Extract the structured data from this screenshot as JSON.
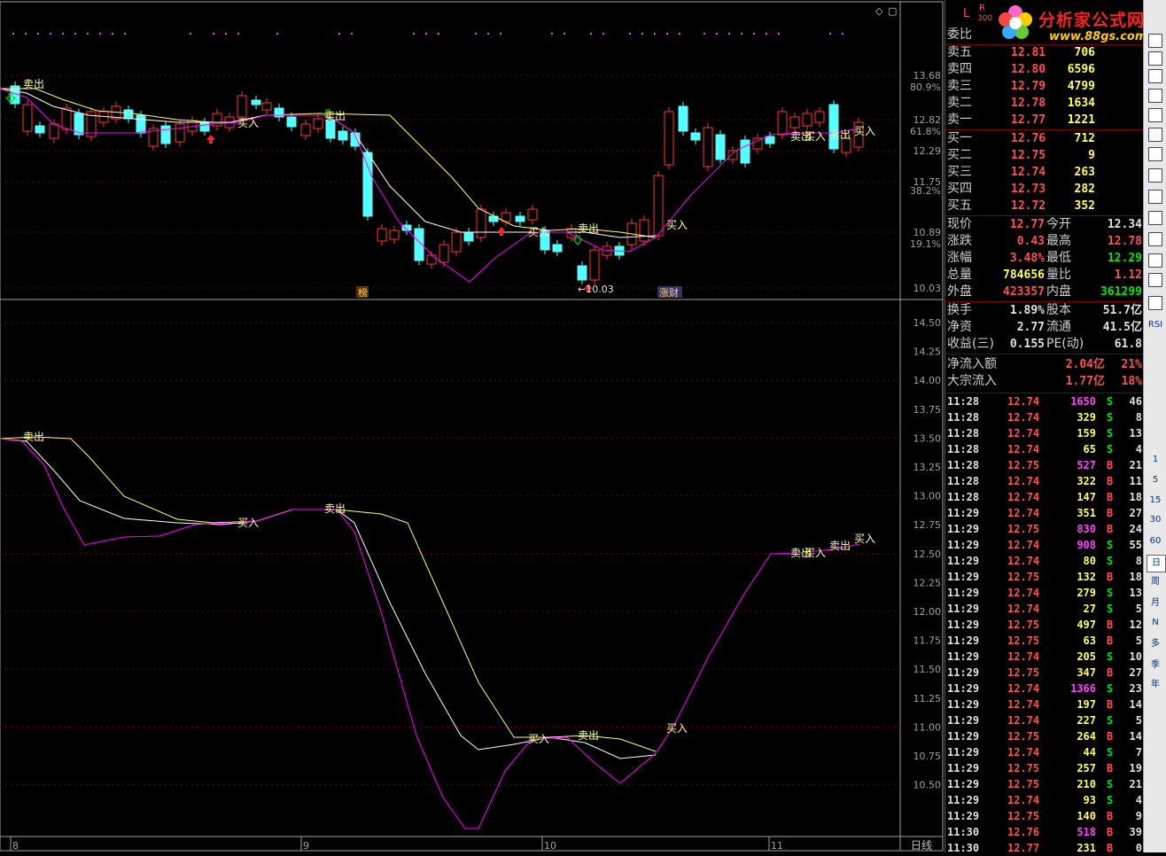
{
  "price_axis": [
    "13.68",
    "12.82",
    "12.29",
    "11.75",
    "10.89",
    "10.03"
  ],
  "fib_axis": [
    "80.9%",
    "61.8%",
    "38.2%",
    "19.1%"
  ],
  "lower_axis": [
    "14.50",
    "14.25",
    "14.00",
    "13.75",
    "13.50",
    "13.25",
    "13.00",
    "12.75",
    "12.50",
    "12.25",
    "12.00",
    "11.75",
    "11.50",
    "11.25",
    "11.00",
    "10.75",
    "10.50"
  ],
  "date_axis": [
    "8",
    "9",
    "10",
    "11"
  ],
  "period_label": "日线",
  "signals": {
    "buy": "买入",
    "sell": "卖出"
  },
  "low_label": "←10.03",
  "event_tags": [
    "榜",
    "涨财"
  ],
  "header": {
    "code_l": "L",
    "code_r": "R",
    "code_n": "300",
    "weibi": "委比"
  },
  "logo": {
    "title": "分析家公式网",
    "url": "www.88gs.com"
  },
  "asks": [
    {
      "label": "卖五",
      "price": "12.81",
      "vol": "706"
    },
    {
      "label": "卖四",
      "price": "12.80",
      "vol": "6596"
    },
    {
      "label": "卖三",
      "price": "12.79",
      "vol": "4799"
    },
    {
      "label": "卖二",
      "price": "12.78",
      "vol": "1634"
    },
    {
      "label": "卖一",
      "price": "12.77",
      "vol": "1221"
    }
  ],
  "bids": [
    {
      "label": "买一",
      "price": "12.76",
      "vol": "712"
    },
    {
      "label": "买二",
      "price": "12.75",
      "vol": "9"
    },
    {
      "label": "买三",
      "price": "12.74",
      "vol": "263"
    },
    {
      "label": "买四",
      "price": "12.73",
      "vol": "282"
    },
    {
      "label": "买五",
      "price": "12.72",
      "vol": "352"
    }
  ],
  "quote": [
    {
      "l1": "现价",
      "v1": "12.77",
      "c1": "red",
      "l2": "今开",
      "v2": "12.34",
      "c2": "wht"
    },
    {
      "l1": "涨跌",
      "v1": "0.43",
      "c1": "red",
      "l2": "最高",
      "v2": "12.78",
      "c2": "red"
    },
    {
      "l1": "涨幅",
      "v1": "3.48%",
      "c1": "red",
      "l2": "最低",
      "v2": "12.29",
      "c2": "grn"
    },
    {
      "l1": "总量",
      "v1": "784656",
      "c1": "yel",
      "l2": "量比",
      "v2": "1.12",
      "c2": "red"
    },
    {
      "l1": "外盘",
      "v1": "423357",
      "c1": "red",
      "l2": "内盘",
      "v2": "361299",
      "c2": "grn"
    }
  ],
  "fund": [
    {
      "l1": "换手",
      "v1": "1.89%",
      "l2": "股本",
      "v2": "51.7亿"
    },
    {
      "l1": "净资",
      "v1": "2.77",
      "l2": "流通",
      "v2": "41.5亿"
    },
    {
      "l1": "收益(三)",
      "v1": "0.155",
      "l2": "PE(动)",
      "v2": "61.8"
    }
  ],
  "flow": [
    {
      "label": "净流入额",
      "value": "2.04亿",
      "pct": "21%"
    },
    {
      "label": "大宗流入",
      "value": "1.77亿",
      "pct": "18%"
    }
  ],
  "ticks": [
    [
      "11:28",
      "12.74",
      "1650",
      "S",
      "46"
    ],
    [
      "11:28",
      "12.74",
      "329",
      "S",
      "8"
    ],
    [
      "11:28",
      "12.74",
      "159",
      "S",
      "13"
    ],
    [
      "11:28",
      "12.74",
      "65",
      "S",
      "4"
    ],
    [
      "11:28",
      "12.75",
      "527",
      "B",
      "21"
    ],
    [
      "11:28",
      "12.74",
      "322",
      "B",
      "11"
    ],
    [
      "11:28",
      "12.74",
      "147",
      "B",
      "18"
    ],
    [
      "11:29",
      "12.74",
      "351",
      "B",
      "27"
    ],
    [
      "11:29",
      "12.75",
      "830",
      "B",
      "24"
    ],
    [
      "11:29",
      "12.74",
      "908",
      "S",
      "55"
    ],
    [
      "11:29",
      "12.74",
      "80",
      "S",
      "8"
    ],
    [
      "11:29",
      "12.75",
      "132",
      "B",
      "18"
    ],
    [
      "11:29",
      "12.74",
      "279",
      "S",
      "13"
    ],
    [
      "11:29",
      "12.74",
      "27",
      "S",
      "5"
    ],
    [
      "11:29",
      "12.75",
      "497",
      "B",
      "12"
    ],
    [
      "11:29",
      "12.75",
      "63",
      "B",
      "5"
    ],
    [
      "11:29",
      "12.74",
      "205",
      "S",
      "10"
    ],
    [
      "11:29",
      "12.75",
      "347",
      "B",
      "27"
    ],
    [
      "11:29",
      "12.74",
      "1366",
      "S",
      "23"
    ],
    [
      "11:29",
      "12.74",
      "197",
      "B",
      "14"
    ],
    [
      "11:29",
      "12.74",
      "227",
      "S",
      "5"
    ],
    [
      "11:29",
      "12.75",
      "264",
      "B",
      "14"
    ],
    [
      "11:29",
      "12.74",
      "44",
      "S",
      "7"
    ],
    [
      "11:29",
      "12.75",
      "257",
      "B",
      "19"
    ],
    [
      "11:29",
      "12.75",
      "210",
      "S",
      "21"
    ],
    [
      "11:29",
      "12.74",
      "93",
      "S",
      "4"
    ],
    [
      "11:29",
      "12.75",
      "140",
      "B",
      "9"
    ],
    [
      "11:30",
      "12.76",
      "518",
      "B",
      "39"
    ],
    [
      "11:30",
      "12.77",
      "231",
      "B",
      "0"
    ]
  ],
  "toolbar_labels": [
    "RSI",
    "1",
    "5",
    "15",
    "30",
    "60",
    "日",
    "周",
    "月",
    "N",
    "多",
    "季",
    "年"
  ],
  "colors": {
    "up": "#ff3232",
    "down": "#54ffff",
    "ma_white": "#ffffff",
    "ma_yellow": "#ffff66",
    "ma_magenta": "#ff00ff",
    "grid": "#7a0000"
  }
}
